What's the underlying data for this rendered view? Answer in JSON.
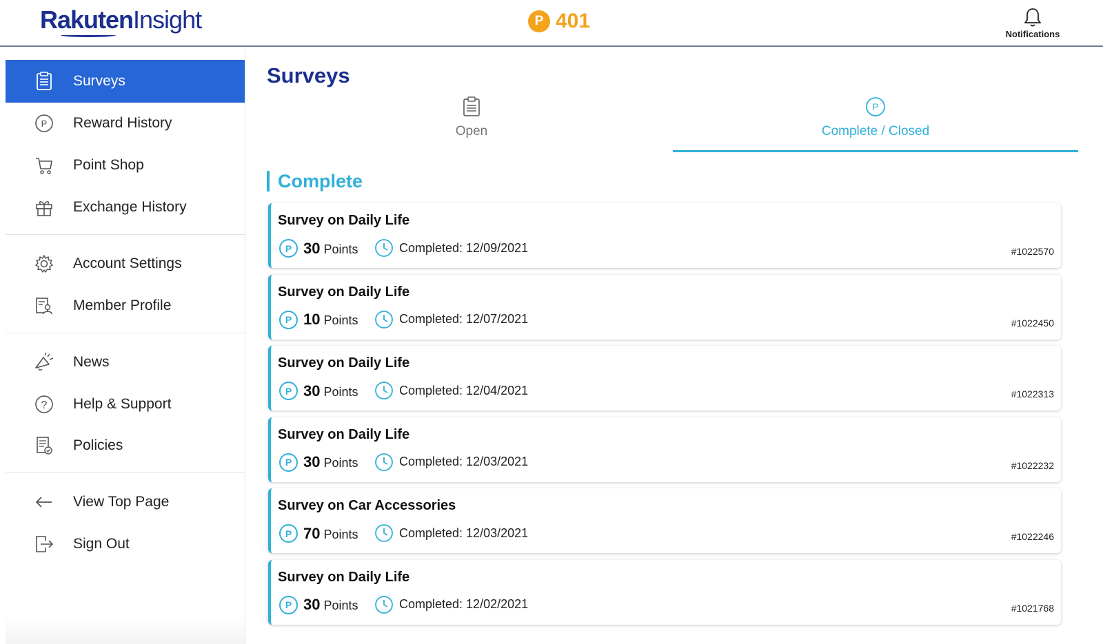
{
  "header": {
    "logo_brand": "Rakuten",
    "logo_sub": "Insight",
    "points_symbol": "P",
    "points_value": "401",
    "notifications_label": "Notifications"
  },
  "sidebar": {
    "items": [
      {
        "label": "Surveys",
        "icon": "clipboard-icon"
      },
      {
        "label": "Reward History",
        "icon": "points-icon"
      },
      {
        "label": "Point Shop",
        "icon": "cart-icon"
      },
      {
        "label": "Exchange History",
        "icon": "gift-icon"
      },
      {
        "label": "Account Settings",
        "icon": "gear-icon"
      },
      {
        "label": "Member Profile",
        "icon": "profile-icon"
      },
      {
        "label": "News",
        "icon": "megaphone-icon"
      },
      {
        "label": "Help & Support",
        "icon": "question-icon"
      },
      {
        "label": "Policies",
        "icon": "policy-icon"
      },
      {
        "label": "View Top Page",
        "icon": "arrow-left-icon"
      },
      {
        "label": "Sign Out",
        "icon": "sign-out-icon"
      }
    ]
  },
  "main": {
    "title": "Surveys",
    "tabs": [
      {
        "label": "Open"
      },
      {
        "label": "Complete / Closed"
      }
    ],
    "section_title": "Complete",
    "points_symbol": "P",
    "surveys": [
      {
        "title": "Survey on Daily Life",
        "points": "30",
        "points_unit": "Points",
        "completed": "Completed: 12/09/2021",
        "id": "#1022570"
      },
      {
        "title": "Survey on Daily Life",
        "points": "10",
        "points_unit": "Points",
        "completed": "Completed: 12/07/2021",
        "id": "#1022450"
      },
      {
        "title": "Survey on Daily Life",
        "points": "30",
        "points_unit": "Points",
        "completed": "Completed: 12/04/2021",
        "id": "#1022313"
      },
      {
        "title": "Survey on Daily Life",
        "points": "30",
        "points_unit": "Points",
        "completed": "Completed: 12/03/2021",
        "id": "#1022232"
      },
      {
        "title": "Survey on Car Accessories",
        "points": "70",
        "points_unit": "Points",
        "completed": "Completed: 12/03/2021",
        "id": "#1022246"
      },
      {
        "title": "Survey on Daily Life",
        "points": "30",
        "points_unit": "Points",
        "completed": "Completed: 12/02/2021",
        "id": "#1021768"
      }
    ]
  },
  "colors": {
    "brand_blue": "#1b2f8f",
    "active_blue": "#2766d6",
    "accent_cyan": "#2fb0d9",
    "points_orange": "#f3a31c"
  }
}
